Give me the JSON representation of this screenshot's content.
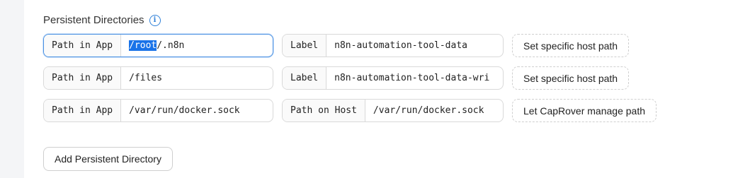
{
  "section": {
    "title": "Persistent Directories",
    "info_icon": "info-icon"
  },
  "rows": [
    {
      "path_label": "Path in App",
      "path_selected": "/root",
      "path_rest": "/.n8n",
      "second_label": "Label",
      "second_value": "n8n-automation-tool-data",
      "action": "Set specific host path"
    },
    {
      "path_label": "Path in App",
      "path_value": "/files",
      "second_label": "Label",
      "second_value": "n8n-automation-tool-data-wri",
      "action": "Set specific host path"
    },
    {
      "path_label": "Path in App",
      "path_value": "/var/run/docker.sock",
      "second_label": "Path on Host",
      "second_value": "/var/run/docker.sock",
      "action": "Let CapRover manage path"
    }
  ],
  "add_button": "Add Persistent Directory",
  "colors": {
    "accent": "#1a73e8",
    "focus_border": "#4a90e2",
    "info": "#2f80d8"
  }
}
